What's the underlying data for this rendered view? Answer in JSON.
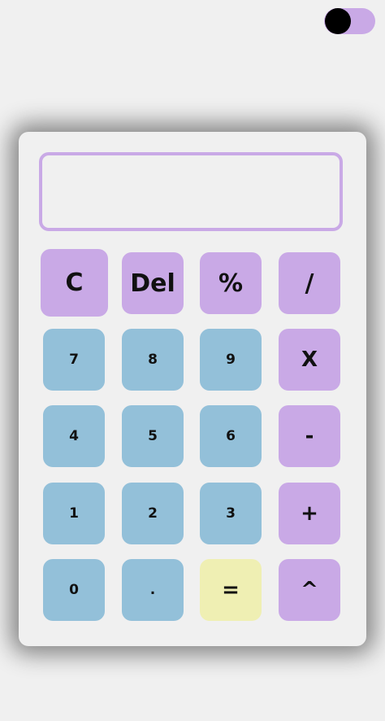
{
  "theme_toggle": {
    "state": "dark-knob-left",
    "track_color": "#c9a9e6",
    "knob_color": "#000000"
  },
  "display": {
    "value": ""
  },
  "keys": {
    "clear": "C",
    "delete": "Del",
    "percent": "%",
    "divide": "/",
    "seven": "7",
    "eight": "8",
    "nine": "9",
    "multiply": "X",
    "four": "4",
    "five": "5",
    "six": "6",
    "minus": "-",
    "one": "1",
    "two": "2",
    "three": "3",
    "plus": "+",
    "zero": "0",
    "decimal": ".",
    "equals": "=",
    "power": "^"
  },
  "colors": {
    "operator": "#c9a9e6",
    "number": "#93c0d9",
    "equals": "#efefb3",
    "background": "#f0f0f0"
  }
}
